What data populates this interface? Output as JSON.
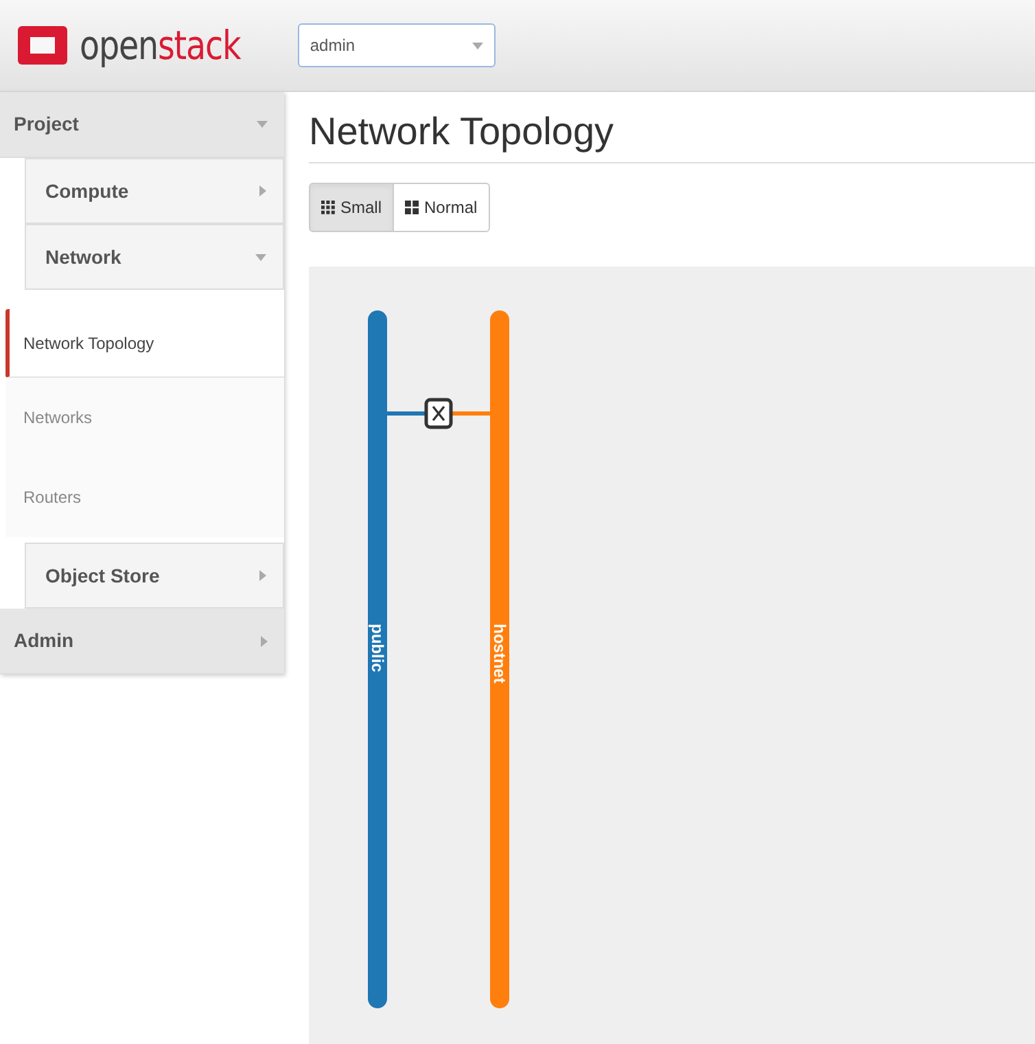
{
  "header": {
    "logo": {
      "part_1": "open",
      "part_2": "stack"
    },
    "project_selector": {
      "value": "admin"
    }
  },
  "sidebar": {
    "items": [
      {
        "label": "Project",
        "expanded": true,
        "children": [
          {
            "label": "Compute",
            "expanded": false
          },
          {
            "label": "Network",
            "expanded": true,
            "children": [
              {
                "label": "Network Topology",
                "selected": true
              },
              {
                "label": "Networks",
                "selected": false
              },
              {
                "label": "Routers",
                "selected": false
              }
            ]
          },
          {
            "label": "Object Store",
            "expanded": false
          }
        ]
      },
      {
        "label": "Admin",
        "expanded": false
      }
    ]
  },
  "page": {
    "title": "Network Topology",
    "view_toggle": [
      {
        "label": "Small",
        "selected": true,
        "kind": "small"
      },
      {
        "label": "Normal",
        "selected": false,
        "kind": "normal"
      }
    ],
    "topology": {
      "networks": [
        {
          "name": "public",
          "color": "#1f77b4"
        },
        {
          "name": "hostnet",
          "color": "#ff7f0e"
        }
      ],
      "routers": [
        {
          "kind": "router"
        }
      ]
    }
  }
}
